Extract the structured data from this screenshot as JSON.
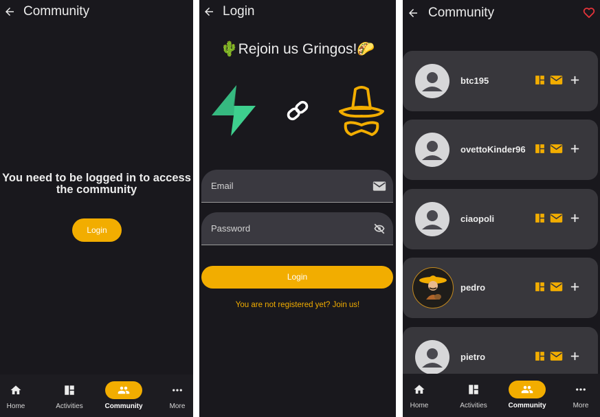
{
  "panel1": {
    "title": "Community",
    "message": "You need to be logged in to access the community",
    "login_button": "Login"
  },
  "panel2": {
    "title": "Login",
    "welcome": "🌵Rejoin us Gringos!🌮",
    "email_placeholder": "Email",
    "password_placeholder": "Password",
    "login_button": "Login",
    "register_link": "You are not registered yet? Join us!"
  },
  "panel3": {
    "title": "Community",
    "users": [
      {
        "name": "btc195"
      },
      {
        "name": "ovettoKinder96"
      },
      {
        "name": "ciaopoli"
      },
      {
        "name": "pedro"
      },
      {
        "name": "pietro"
      }
    ]
  },
  "nav": {
    "home": "Home",
    "activities": "Activities",
    "community": "Community",
    "more": "More",
    "active": "community"
  },
  "colors": {
    "accent": "#f2ad00",
    "background": "#19181d",
    "card": "#38373c",
    "supabase_green": "#3ecf8e"
  },
  "icons": [
    "back-arrow-icon",
    "home-icon",
    "dashboard-icon",
    "people-icon",
    "more-dots-icon",
    "mail-icon",
    "eye-off-icon",
    "link-icon",
    "supabase-logo-icon",
    "sombrero-mustache-logo-icon",
    "heart-outline-icon",
    "plus-icon",
    "person-avatar-icon"
  ]
}
